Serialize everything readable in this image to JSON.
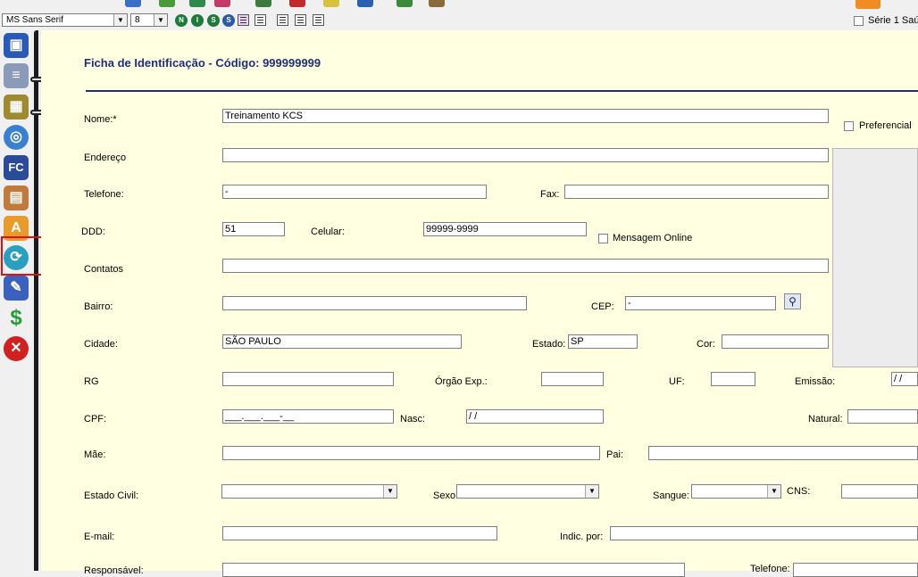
{
  "toolbar": {
    "font_name": "MS Sans Serif",
    "font_size": "8",
    "serie_label": "Série 1 Saú"
  },
  "form": {
    "title": "Ficha de Identificação - Código: 999999999",
    "labels": {
      "nome": "Nome:*",
      "preferencial": "Preferencial",
      "endereco": "Endereço",
      "telefone": "Telefone:",
      "fax": "Fax:",
      "ddd": "DDD:",
      "celular": "Celular:",
      "mensagem_online": "Mensagem Online",
      "contatos": "Contatos",
      "bairro": "Bairro:",
      "cep": "CEP:",
      "cidade": "Cidade:",
      "estado": "Estado:",
      "cor": "Cor:",
      "rg": "RG",
      "orgao_exp": "Órgão Exp.:",
      "uf": "UF:",
      "emissao": "Emissão:",
      "cpf": "CPF:",
      "nasc": "Nasc:",
      "natural": "Natural:",
      "mae": "Mãe:",
      "pai": "Pai:",
      "estado_civil": "Estado Civil:",
      "sexo": "Sexo",
      "sangue": "Sangue:",
      "cns": "CNS:",
      "email": "E-mail:",
      "indic_por": "Indic. por:",
      "responsavel": "Responsável:",
      "telefone2": "Telefone:"
    },
    "values": {
      "nome": "Treinamento KCS",
      "telefone": "   -",
      "ddd": "51",
      "celular": "99999-9999",
      "cep": "     -",
      "cidade": "SÃO PAULO",
      "estado": "SP",
      "emissao": " /  /",
      "cpf": "___.___.___-__",
      "nasc": " /  /"
    }
  },
  "sidebar": {
    "icons": [
      "save-icon",
      "documents-icon",
      "film-icon",
      "disc-icon",
      "fc-icon",
      "books-icon",
      "font-a-icon",
      "refresh-icon",
      "ruler-pencil-icon",
      "dollar-icon",
      "close-icon"
    ]
  }
}
